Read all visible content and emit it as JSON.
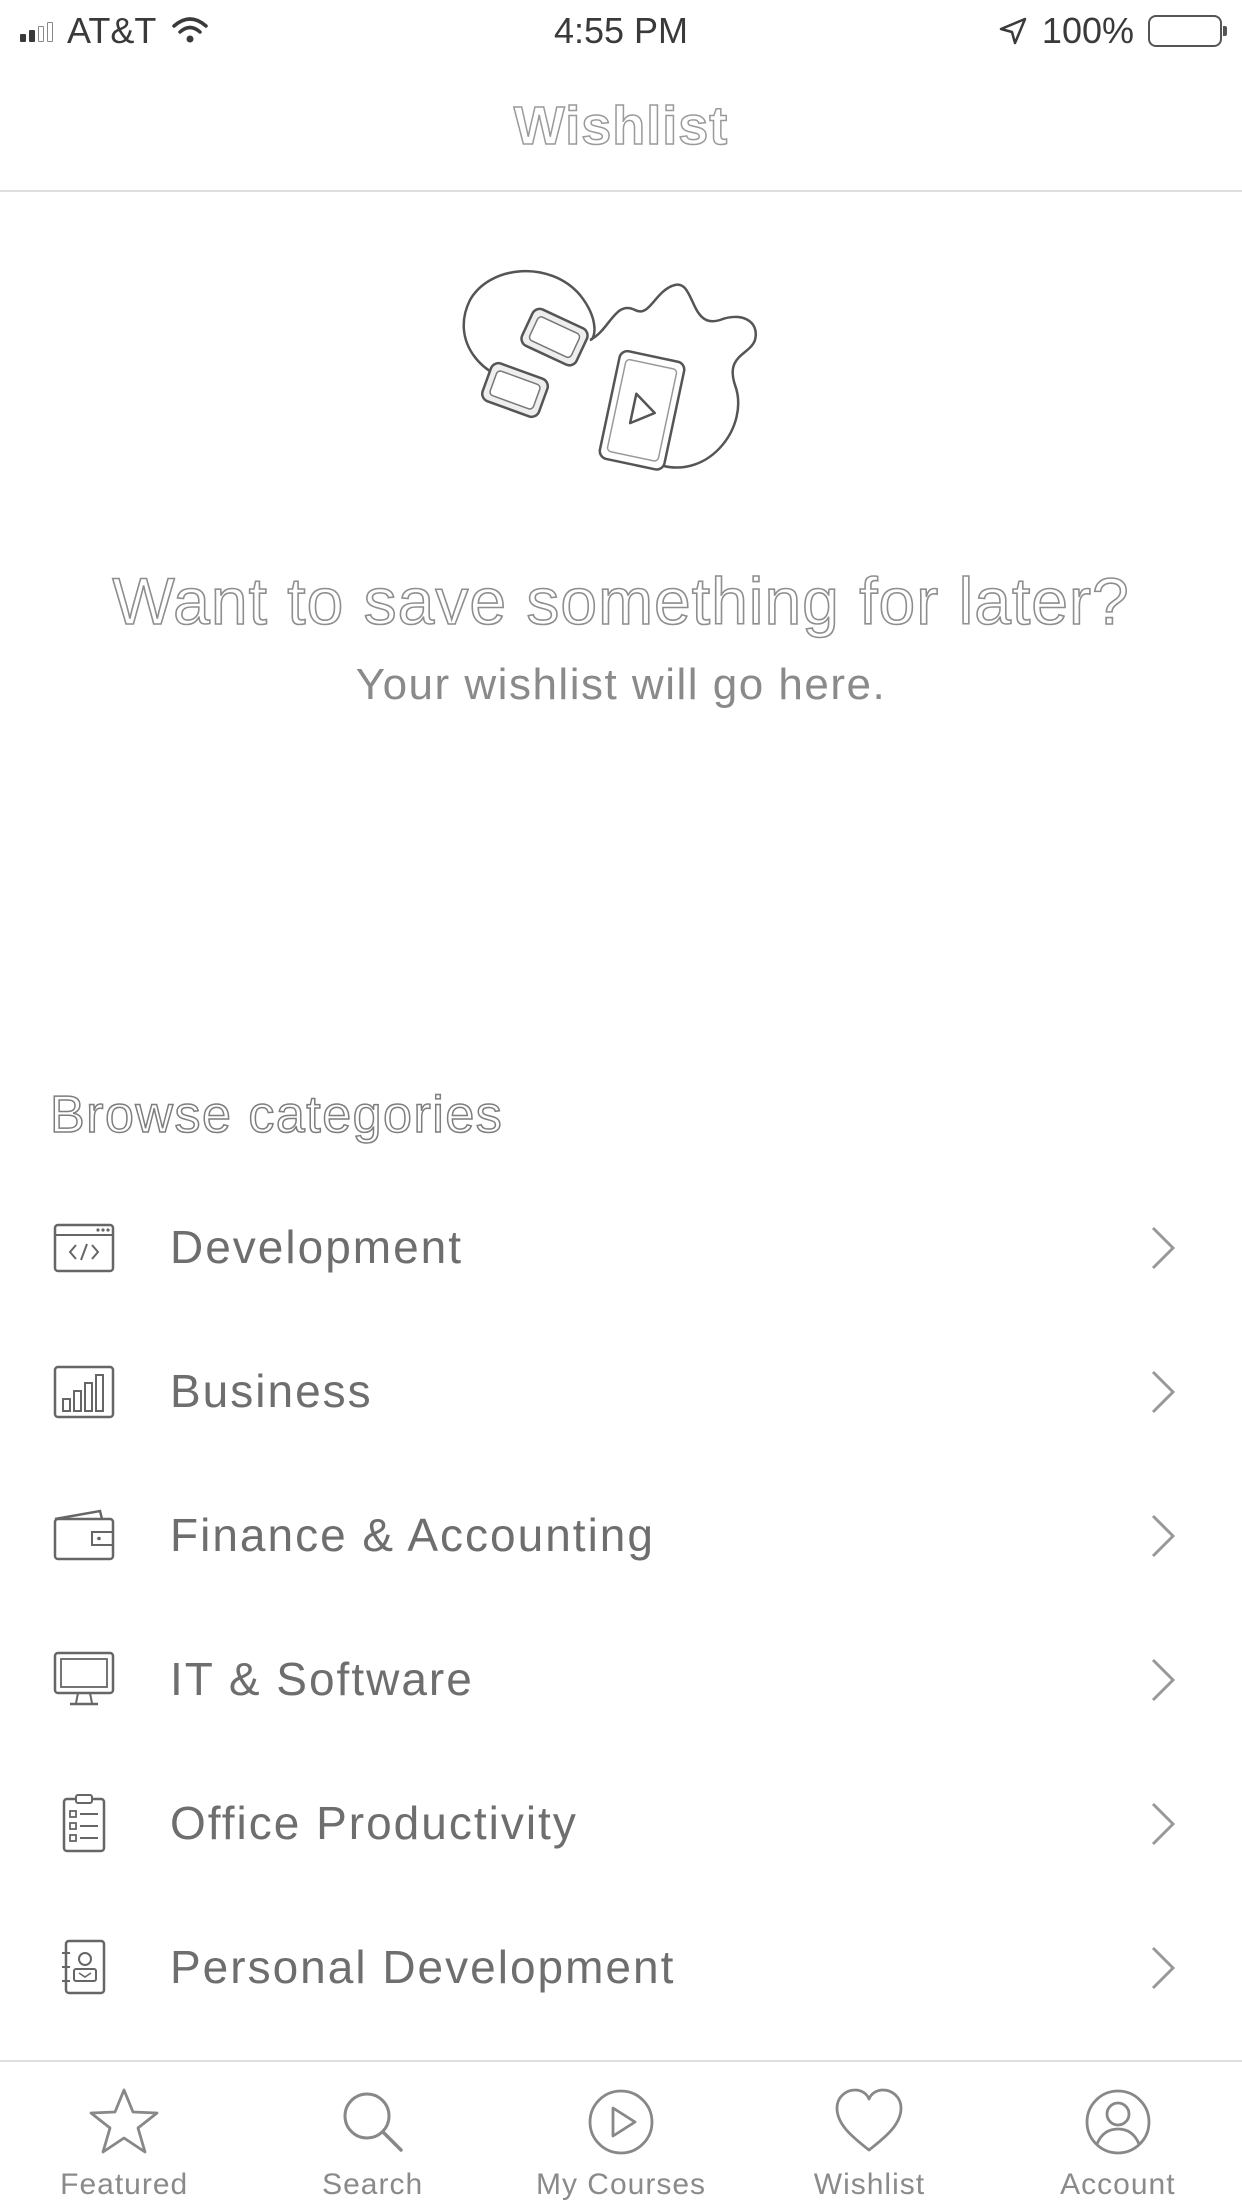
{
  "status_bar": {
    "carrier": "AT&T",
    "time": "4:55 PM",
    "battery": "100%"
  },
  "nav": {
    "title": "Wishlist"
  },
  "empty_state": {
    "title": "Want to save something for later?",
    "subtitle": "Your wishlist will go here."
  },
  "browse": {
    "title": "Browse categories",
    "categories": [
      {
        "label": "Development",
        "icon": "code-window-icon"
      },
      {
        "label": "Business",
        "icon": "bar-chart-icon"
      },
      {
        "label": "Finance & Accounting",
        "icon": "wallet-icon"
      },
      {
        "label": "IT & Software",
        "icon": "monitor-icon"
      },
      {
        "label": "Office Productivity",
        "icon": "clipboard-list-icon"
      },
      {
        "label": "Personal Development",
        "icon": "contact-book-icon"
      }
    ]
  },
  "tab_bar": {
    "tabs": [
      {
        "label": "Featured",
        "icon": "star-icon"
      },
      {
        "label": "Search",
        "icon": "search-icon"
      },
      {
        "label": "My Courses",
        "icon": "play-circle-icon"
      },
      {
        "label": "Wishlist",
        "icon": "heart-icon"
      },
      {
        "label": "Account",
        "icon": "user-circle-icon"
      }
    ]
  }
}
